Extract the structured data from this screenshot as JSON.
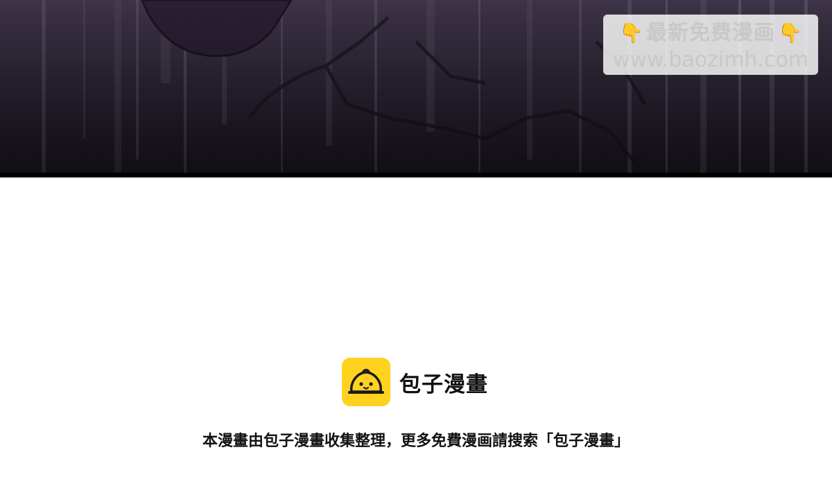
{
  "watermark": {
    "hand_icon": "pointing-down-hand-icon",
    "title": "最新免费漫画",
    "url": "www.baozimh.com"
  },
  "brand": {
    "logo_icon": "baozi-bun-logo-icon",
    "name": "包子漫畫",
    "logo_color": "#ffd21f"
  },
  "notice": {
    "text": "本漫畫由包子漫畫收集整理，更多免費漫画請搜索「包子漫畫」"
  }
}
